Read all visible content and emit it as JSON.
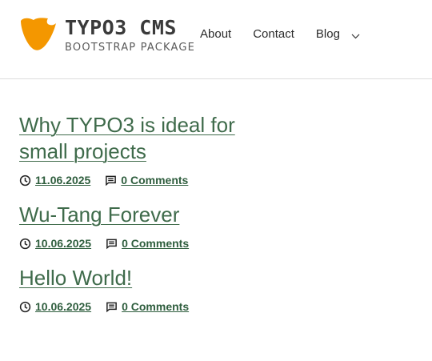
{
  "brand": {
    "title": "TYPO3 CMS",
    "subtitle": "BOOTSTRAP PACKAGE",
    "logo_color": "#f49700"
  },
  "nav": {
    "items": [
      {
        "label": "About"
      },
      {
        "label": "Contact"
      },
      {
        "label": "Blog"
      }
    ]
  },
  "posts": [
    {
      "title": "Why TYPO3 is ideal for small projects",
      "date": "11.06.2025",
      "comments": "0 Comments"
    },
    {
      "title": "Wu-Tang Forever",
      "date": "10.06.2025",
      "comments": "0 Comments"
    },
    {
      "title": "Hello World!",
      "date": "10.06.2025",
      "comments": "0 Comments"
    }
  ],
  "colors": {
    "link": "#3f6b4b",
    "meta_link": "#2f5e3e"
  },
  "icons": {
    "date": "clock-icon",
    "comments": "comment-icon",
    "dropdown": "chevron-down-icon"
  }
}
